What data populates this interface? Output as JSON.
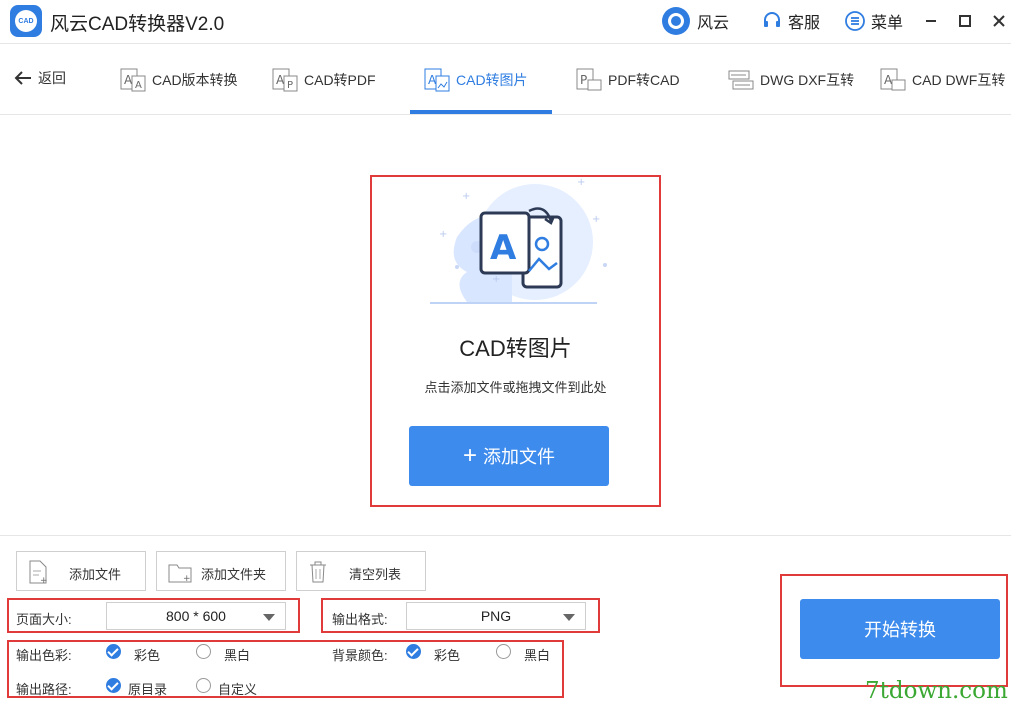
{
  "app": {
    "title": "风云CAD转换器V2.0",
    "logo_text": "CAD"
  },
  "titlebar": {
    "fengyun": "风云",
    "service": "客服",
    "menu": "菜单"
  },
  "nav": {
    "back": "返回",
    "tabs": [
      {
        "label": "CAD版本转换",
        "icon": "cad-version-icon"
      },
      {
        "label": "CAD转PDF",
        "icon": "cad-pdf-icon"
      },
      {
        "label": "CAD转图片",
        "icon": "cad-image-icon"
      },
      {
        "label": "PDF转CAD",
        "icon": "pdf-cad-icon"
      },
      {
        "label": "DWG DXF互转",
        "icon": "dwg-dxf-icon"
      },
      {
        "label": "CAD DWF互转",
        "icon": "cad-dwf-icon"
      }
    ],
    "active_tab": 2
  },
  "drop": {
    "title": "CAD转图片",
    "hint": "点击添加文件或拖拽文件到此处",
    "add_button": "添加文件"
  },
  "toolbar": {
    "add_file": "添加文件",
    "add_folder": "添加文件夹",
    "clear_list": "清空列表"
  },
  "options": {
    "page_size_label": "页面大小:",
    "page_size_value": "800 * 600",
    "format_label": "输出格式:",
    "format_value": "PNG",
    "color_label": "输出色彩:",
    "color_options": [
      "彩色",
      "黑白"
    ],
    "bg_label": "背景颜色:",
    "bg_options": [
      "彩色",
      "黑白"
    ],
    "path_label": "输出路径:",
    "path_options": [
      "原目录",
      "自定义"
    ]
  },
  "start_button": "开始转换",
  "watermark": "7tdown.com",
  "colors": {
    "accent": "#2f7de1",
    "button": "#3d8bec",
    "highlight": "#e03a3a"
  }
}
